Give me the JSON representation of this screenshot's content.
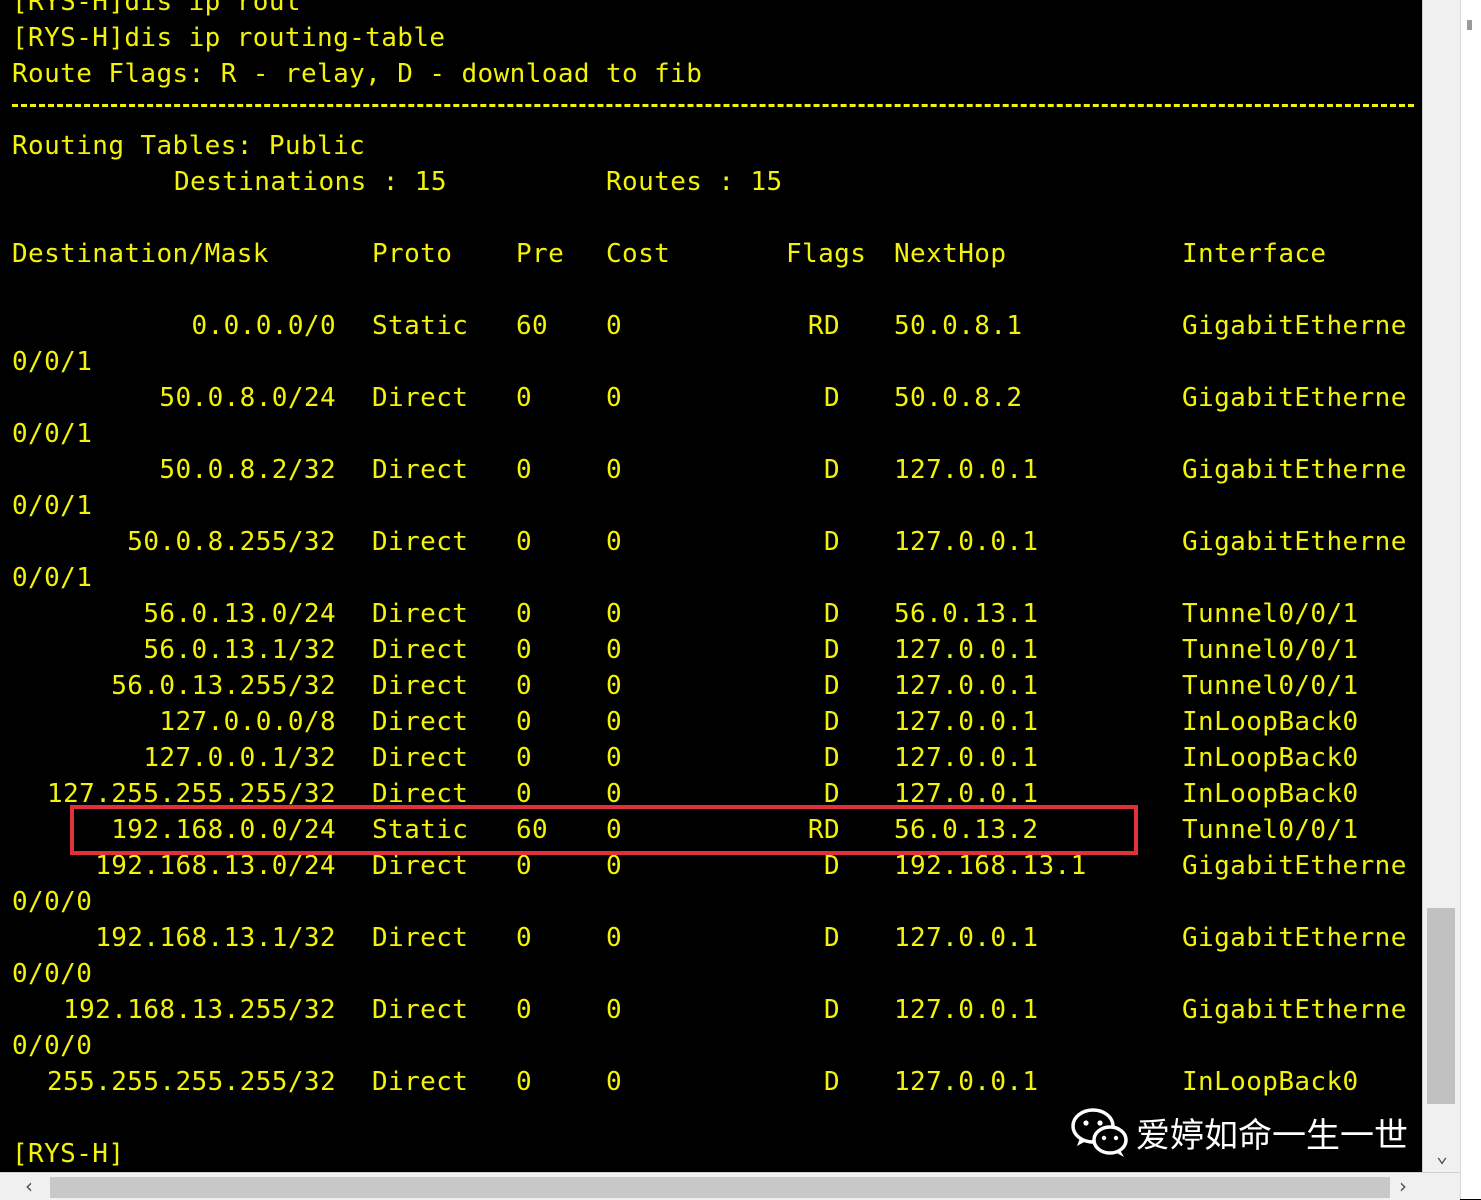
{
  "terminal": {
    "prev_command": "[RYS-H]dis ip rout",
    "command": "[RYS-H]dis ip routing-table",
    "route_flags": "Route Flags: R - relay, D - download to fib",
    "tables_title": "Routing Tables: Public",
    "destinations_label": "Destinations : 15",
    "routes_label": "Routes : 15",
    "headers": {
      "destination": "Destination/Mask",
      "proto": "Proto",
      "pre": "Pre",
      "cost": "Cost",
      "flags": "Flags",
      "nexthop": "NextHop",
      "interface": "Interface"
    },
    "rows": [
      {
        "dest": "0.0.0.0/0",
        "proto": "Static",
        "pre": "60",
        "cost": "0",
        "flags": "RD",
        "nexthop": "50.0.8.1",
        "iface": "GigabitEtherne",
        "cont": "0/0/1"
      },
      {
        "dest": "50.0.8.0/24",
        "proto": "Direct",
        "pre": "0",
        "cost": "0",
        "flags": "D",
        "nexthop": "50.0.8.2",
        "iface": "GigabitEtherne",
        "cont": "0/0/1"
      },
      {
        "dest": "50.0.8.2/32",
        "proto": "Direct",
        "pre": "0",
        "cost": "0",
        "flags": "D",
        "nexthop": "127.0.0.1",
        "iface": "GigabitEtherne",
        "cont": "0/0/1"
      },
      {
        "dest": "50.0.8.255/32",
        "proto": "Direct",
        "pre": "0",
        "cost": "0",
        "flags": "D",
        "nexthop": "127.0.0.1",
        "iface": "GigabitEtherne",
        "cont": "0/0/1"
      },
      {
        "dest": "56.0.13.0/24",
        "proto": "Direct",
        "pre": "0",
        "cost": "0",
        "flags": "D",
        "nexthop": "56.0.13.1",
        "iface": "Tunnel0/0/1",
        "cont": ""
      },
      {
        "dest": "56.0.13.1/32",
        "proto": "Direct",
        "pre": "0",
        "cost": "0",
        "flags": "D",
        "nexthop": "127.0.0.1",
        "iface": "Tunnel0/0/1",
        "cont": ""
      },
      {
        "dest": "56.0.13.255/32",
        "proto": "Direct",
        "pre": "0",
        "cost": "0",
        "flags": "D",
        "nexthop": "127.0.0.1",
        "iface": "Tunnel0/0/1",
        "cont": ""
      },
      {
        "dest": "127.0.0.0/8",
        "proto": "Direct",
        "pre": "0",
        "cost": "0",
        "flags": "D",
        "nexthop": "127.0.0.1",
        "iface": "InLoopBack0",
        "cont": ""
      },
      {
        "dest": "127.0.0.1/32",
        "proto": "Direct",
        "pre": "0",
        "cost": "0",
        "flags": "D",
        "nexthop": "127.0.0.1",
        "iface": "InLoopBack0",
        "cont": ""
      },
      {
        "dest": "127.255.255.255/32",
        "proto": "Direct",
        "pre": "0",
        "cost": "0",
        "flags": "D",
        "nexthop": "127.0.0.1",
        "iface": "InLoopBack0",
        "cont": ""
      },
      {
        "dest": "192.168.0.0/24",
        "proto": "Static",
        "pre": "60",
        "cost": "0",
        "flags": "RD",
        "nexthop": "56.0.13.2",
        "iface": "Tunnel0/0/1",
        "cont": "",
        "highlighted": true
      },
      {
        "dest": "192.168.13.0/24",
        "proto": "Direct",
        "pre": "0",
        "cost": "0",
        "flags": "D",
        "nexthop": "192.168.13.1",
        "iface": "GigabitEtherne",
        "cont": "0/0/0"
      },
      {
        "dest": "192.168.13.1/32",
        "proto": "Direct",
        "pre": "0",
        "cost": "0",
        "flags": "D",
        "nexthop": "127.0.0.1",
        "iface": "GigabitEtherne",
        "cont": "0/0/0"
      },
      {
        "dest": "192.168.13.255/32",
        "proto": "Direct",
        "pre": "0",
        "cost": "0",
        "flags": "D",
        "nexthop": "127.0.0.1",
        "iface": "GigabitEtherne",
        "cont": "0/0/0"
      },
      {
        "dest": "255.255.255.255/32",
        "proto": "Direct",
        "pre": "0",
        "cost": "0",
        "flags": "D",
        "nexthop": "127.0.0.1",
        "iface": "InLoopBack0",
        "cont": ""
      }
    ],
    "prompt": "[RYS-H]"
  },
  "watermark": {
    "icon": "wechat-icon",
    "text": "爱婷如命一生一世"
  },
  "colors": {
    "background": "#000000",
    "text": "#f2f20a",
    "highlight_border": "#e0303a"
  }
}
